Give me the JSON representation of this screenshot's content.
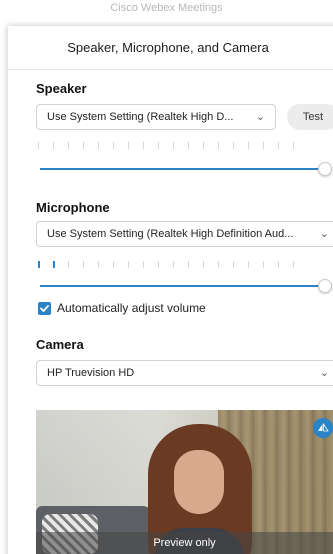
{
  "app": {
    "title": "Cisco Webex Meetings"
  },
  "dialog": {
    "title": "Speaker, Microphone, and Camera"
  },
  "speaker": {
    "section_title": "Speaker",
    "device": "Use System Setting (Realtek High D...",
    "test_label": "Test",
    "level": 0.0,
    "volume": 1.0
  },
  "microphone": {
    "section_title": "Microphone",
    "device": "Use System Setting (Realtek High Definition Aud...",
    "level": 0.1,
    "volume": 1.0,
    "auto_adjust_label": "Automatically adjust volume",
    "auto_adjust_checked": true
  },
  "camera": {
    "section_title": "Camera",
    "device": "HP Truevision HD",
    "preview_caption": "Preview only"
  },
  "colors": {
    "accent": "#2a84c8",
    "meter_inactive": "#d6d6d6"
  },
  "icons": {
    "dropdown": "chevron-down-icon",
    "checkbox": "checkmark-icon",
    "mirror": "mirror-icon"
  }
}
